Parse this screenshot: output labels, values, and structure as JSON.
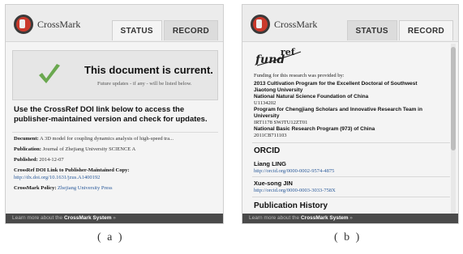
{
  "panel_a": {
    "logo_text": "CrossMark",
    "tabs": [
      "STATUS",
      "RECORD"
    ],
    "current_title": "This document is current.",
    "current_sub": "Future updates - if any - will be listed below.",
    "use_text": "Use the CrossRef DOI link below to access the publisher-maintained version and check for updates.",
    "document_label": "Document:",
    "document_value": "A 3D model for coupling dynamics analysis of high-speed tra...",
    "publication_label": "Publication:",
    "publication_value": "Journal of Zhejiang University SCIENCE A",
    "published_label": "Published:",
    "published_value": "2014-12-07",
    "doi_label": "CrossRef DOI Link to Publisher-Maintained Copy:",
    "doi_link": "http://dx.doi.org/10.1631/jzus.A1400192",
    "policy_label": "CrossMark Policy:",
    "policy_value": "Zhejiang University Press",
    "footer_prefix": "Learn more about the ",
    "footer_link": "CrossMark System",
    "footer_suffix": " »",
    "caption": "( a )"
  },
  "panel_b": {
    "logo_text": "CrossMark",
    "tabs": [
      "STATUS",
      "RECORD"
    ],
    "fundref_logo": "fundref",
    "funding_intro": "Funding for this research was provided by:",
    "funders": [
      {
        "name": "2013 Cultivation Program for the Excellent Doctoral of Southwest",
        "name2": "Jiaotong University",
        "id": ""
      },
      {
        "name": "National Natural Science Foundation of China",
        "name2": "",
        "id": "U1134202"
      },
      {
        "name": "Program for Chengjiang Scholars and Innovative Research Team in",
        "name2": "University",
        "id": "IRT1178 SWJTU12ZT01"
      },
      {
        "name": "National Basic Research Program (973) of China",
        "name2": "",
        "id": "2011CB711103"
      }
    ],
    "orcid_heading": "ORCID",
    "authors": [
      {
        "name": "Liang LING",
        "link": "http://orcid.org/0000-0002-9574-4875"
      },
      {
        "name": "Xue-song JIN",
        "link": "http://orcid.org/0000-0003-3033-758X"
      }
    ],
    "history_heading": "Publication History",
    "footer_prefix": "Learn more about the ",
    "footer_link": "CrossMark System",
    "footer_suffix": " »",
    "caption": "( b )"
  },
  "colors": {
    "logo_red": "#c9392c",
    "check_green": "#6aa84f",
    "link_blue": "#2a5a9a"
  }
}
